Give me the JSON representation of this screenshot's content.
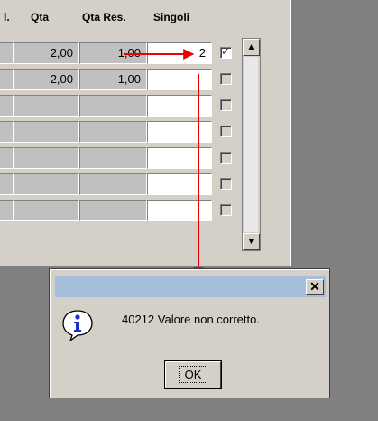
{
  "grid": {
    "headers": [
      "l.",
      "Qta",
      "Qta Res.",
      "Singoli"
    ],
    "rows": [
      {
        "qta": "2,00",
        "qta_res": "1,00",
        "singoli": "2",
        "checked": true
      },
      {
        "qta": "2,00",
        "qta_res": "1,00",
        "singoli": "",
        "checked": false
      },
      {
        "qta": "",
        "qta_res": "",
        "singoli": "",
        "checked": false
      },
      {
        "qta": "",
        "qta_res": "",
        "singoli": "",
        "checked": false
      },
      {
        "qta": "",
        "qta_res": "",
        "singoli": "",
        "checked": false
      },
      {
        "qta": "",
        "qta_res": "",
        "singoli": "",
        "checked": false
      },
      {
        "qta": "",
        "qta_res": "",
        "singoli": "",
        "checked": false
      }
    ]
  },
  "scrollbar": {
    "up_icon": "triangle-up",
    "down_icon": "triangle-down"
  },
  "dialog": {
    "close_label": "✕",
    "message": "40212 Valore non corretto.",
    "ok_label": "OK",
    "icon": "info-icon"
  },
  "colors": {
    "titlebar": "#a4bedc",
    "arrow": "#ee0000",
    "info_blue": "#1a2cc9"
  }
}
